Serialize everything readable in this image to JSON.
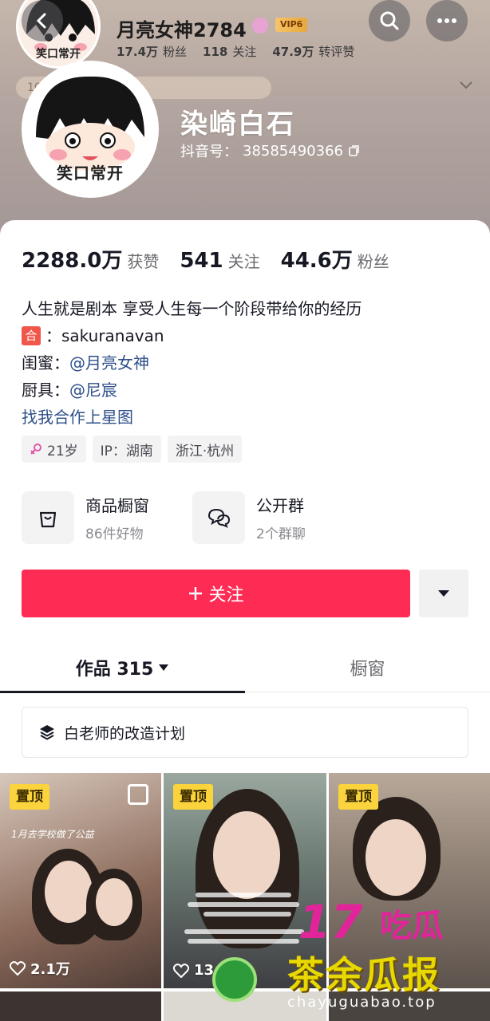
{
  "header": {
    "top_name": "月亮女神2784",
    "vip_label": "VIP6",
    "top_stats": [
      {
        "num": "17.4万",
        "label": "粉丝"
      },
      {
        "num": "118",
        "label": "关注"
      },
      {
        "num": "47.9万",
        "label": "转评赞"
      }
    ],
    "faded_banner": "10万+，互动数1084",
    "mini_avatar_caption": "笑口常开"
  },
  "profile": {
    "avatar_caption": "笑口常开",
    "name": "染崎白石",
    "douyin_id_label": "抖音号：",
    "douyin_id": "38585490366"
  },
  "stats": [
    {
      "num": "2288.0万",
      "label": "获赞"
    },
    {
      "num": "541",
      "label": "关注"
    },
    {
      "num": "44.6万",
      "label": "粉丝"
    }
  ],
  "bio": {
    "line1": "人生就是剧本 享受人生每一个阶段带给你的经历",
    "he_tag": "合",
    "he_text": "：sakuranavan",
    "bestie_label": "闺蜜：",
    "bestie_link": "@月亮女神",
    "cook_label": "厨具：",
    "cook_link": "@尼宸",
    "cooperation_link": "找我合作上星图"
  },
  "tags": {
    "age": "21岁",
    "ip": "IP：湖南",
    "location": "浙江·杭州"
  },
  "shortcuts": [
    {
      "title": "商品橱窗",
      "sub": "86件好物",
      "icon": "shopping-bag-icon"
    },
    {
      "title": "公开群",
      "sub": "2个群聊",
      "icon": "chat-bubbles-icon"
    }
  ],
  "actions": {
    "follow_label": "关注",
    "follow_icon": "plus-icon"
  },
  "tabs": {
    "works_label": "作品 315",
    "window_label": "橱窗"
  },
  "collection": {
    "label": "白老师的改造计划"
  },
  "videos": [
    {
      "pin": "置顶",
      "likes": "2.1万",
      "caption": "1月去学校做了公益"
    },
    {
      "pin": "置顶",
      "likes": "13"
    },
    {
      "pin": "置顶",
      "likes": ""
    }
  ],
  "watermark": {
    "top": "吃瓜",
    "number": "17",
    "main": "茶余瓜报",
    "url": "chayuguabao.top"
  },
  "colors": {
    "accent": "#fe2c55",
    "link": "#2e4f8a",
    "pin": "#fbd33c"
  }
}
